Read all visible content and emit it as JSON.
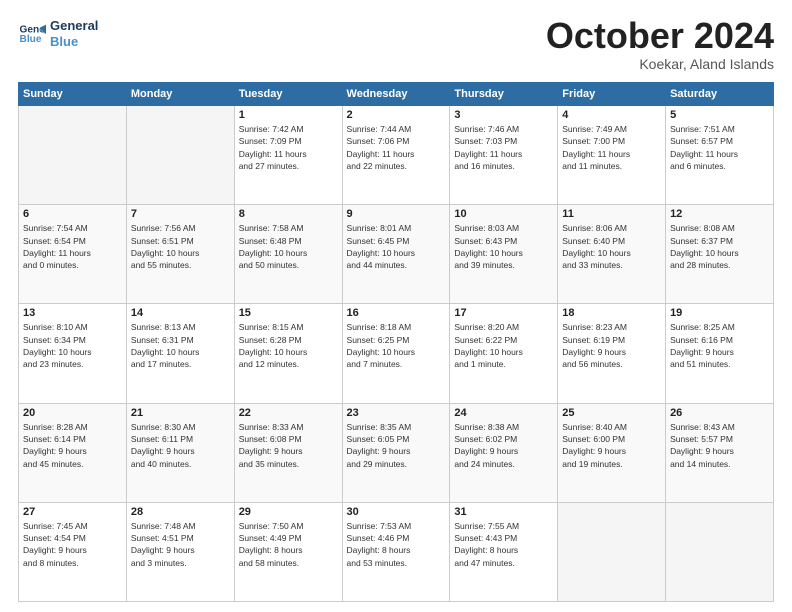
{
  "header": {
    "logo_line1": "General",
    "logo_line2": "Blue",
    "month": "October 2024",
    "location": "Koekar, Aland Islands"
  },
  "weekdays": [
    "Sunday",
    "Monday",
    "Tuesday",
    "Wednesday",
    "Thursday",
    "Friday",
    "Saturday"
  ],
  "weeks": [
    [
      {
        "day": "",
        "info": ""
      },
      {
        "day": "",
        "info": ""
      },
      {
        "day": "1",
        "info": "Sunrise: 7:42 AM\nSunset: 7:09 PM\nDaylight: 11 hours\nand 27 minutes."
      },
      {
        "day": "2",
        "info": "Sunrise: 7:44 AM\nSunset: 7:06 PM\nDaylight: 11 hours\nand 22 minutes."
      },
      {
        "day": "3",
        "info": "Sunrise: 7:46 AM\nSunset: 7:03 PM\nDaylight: 11 hours\nand 16 minutes."
      },
      {
        "day": "4",
        "info": "Sunrise: 7:49 AM\nSunset: 7:00 PM\nDaylight: 11 hours\nand 11 minutes."
      },
      {
        "day": "5",
        "info": "Sunrise: 7:51 AM\nSunset: 6:57 PM\nDaylight: 11 hours\nand 6 minutes."
      }
    ],
    [
      {
        "day": "6",
        "info": "Sunrise: 7:54 AM\nSunset: 6:54 PM\nDaylight: 11 hours\nand 0 minutes."
      },
      {
        "day": "7",
        "info": "Sunrise: 7:56 AM\nSunset: 6:51 PM\nDaylight: 10 hours\nand 55 minutes."
      },
      {
        "day": "8",
        "info": "Sunrise: 7:58 AM\nSunset: 6:48 PM\nDaylight: 10 hours\nand 50 minutes."
      },
      {
        "day": "9",
        "info": "Sunrise: 8:01 AM\nSunset: 6:45 PM\nDaylight: 10 hours\nand 44 minutes."
      },
      {
        "day": "10",
        "info": "Sunrise: 8:03 AM\nSunset: 6:43 PM\nDaylight: 10 hours\nand 39 minutes."
      },
      {
        "day": "11",
        "info": "Sunrise: 8:06 AM\nSunset: 6:40 PM\nDaylight: 10 hours\nand 33 minutes."
      },
      {
        "day": "12",
        "info": "Sunrise: 8:08 AM\nSunset: 6:37 PM\nDaylight: 10 hours\nand 28 minutes."
      }
    ],
    [
      {
        "day": "13",
        "info": "Sunrise: 8:10 AM\nSunset: 6:34 PM\nDaylight: 10 hours\nand 23 minutes."
      },
      {
        "day": "14",
        "info": "Sunrise: 8:13 AM\nSunset: 6:31 PM\nDaylight: 10 hours\nand 17 minutes."
      },
      {
        "day": "15",
        "info": "Sunrise: 8:15 AM\nSunset: 6:28 PM\nDaylight: 10 hours\nand 12 minutes."
      },
      {
        "day": "16",
        "info": "Sunrise: 8:18 AM\nSunset: 6:25 PM\nDaylight: 10 hours\nand 7 minutes."
      },
      {
        "day": "17",
        "info": "Sunrise: 8:20 AM\nSunset: 6:22 PM\nDaylight: 10 hours\nand 1 minute."
      },
      {
        "day": "18",
        "info": "Sunrise: 8:23 AM\nSunset: 6:19 PM\nDaylight: 9 hours\nand 56 minutes."
      },
      {
        "day": "19",
        "info": "Sunrise: 8:25 AM\nSunset: 6:16 PM\nDaylight: 9 hours\nand 51 minutes."
      }
    ],
    [
      {
        "day": "20",
        "info": "Sunrise: 8:28 AM\nSunset: 6:14 PM\nDaylight: 9 hours\nand 45 minutes."
      },
      {
        "day": "21",
        "info": "Sunrise: 8:30 AM\nSunset: 6:11 PM\nDaylight: 9 hours\nand 40 minutes."
      },
      {
        "day": "22",
        "info": "Sunrise: 8:33 AM\nSunset: 6:08 PM\nDaylight: 9 hours\nand 35 minutes."
      },
      {
        "day": "23",
        "info": "Sunrise: 8:35 AM\nSunset: 6:05 PM\nDaylight: 9 hours\nand 29 minutes."
      },
      {
        "day": "24",
        "info": "Sunrise: 8:38 AM\nSunset: 6:02 PM\nDaylight: 9 hours\nand 24 minutes."
      },
      {
        "day": "25",
        "info": "Sunrise: 8:40 AM\nSunset: 6:00 PM\nDaylight: 9 hours\nand 19 minutes."
      },
      {
        "day": "26",
        "info": "Sunrise: 8:43 AM\nSunset: 5:57 PM\nDaylight: 9 hours\nand 14 minutes."
      }
    ],
    [
      {
        "day": "27",
        "info": "Sunrise: 7:45 AM\nSunset: 4:54 PM\nDaylight: 9 hours\nand 8 minutes."
      },
      {
        "day": "28",
        "info": "Sunrise: 7:48 AM\nSunset: 4:51 PM\nDaylight: 9 hours\nand 3 minutes."
      },
      {
        "day": "29",
        "info": "Sunrise: 7:50 AM\nSunset: 4:49 PM\nDaylight: 8 hours\nand 58 minutes."
      },
      {
        "day": "30",
        "info": "Sunrise: 7:53 AM\nSunset: 4:46 PM\nDaylight: 8 hours\nand 53 minutes."
      },
      {
        "day": "31",
        "info": "Sunrise: 7:55 AM\nSunset: 4:43 PM\nDaylight: 8 hours\nand 47 minutes."
      },
      {
        "day": "",
        "info": ""
      },
      {
        "day": "",
        "info": ""
      }
    ]
  ]
}
